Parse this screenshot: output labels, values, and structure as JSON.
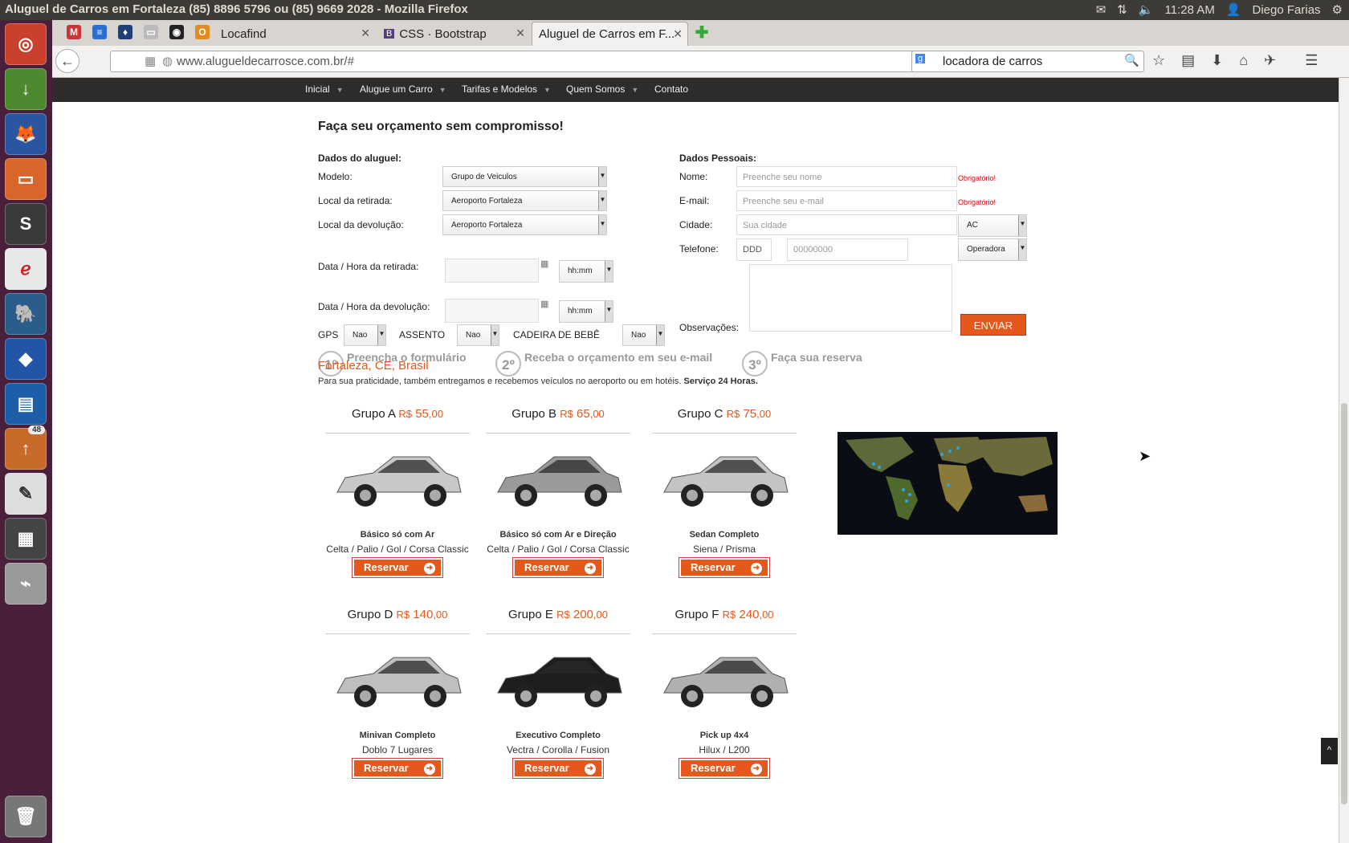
{
  "window_title": "Aluguel de Carros em Fortaleza (85) 8896 5796 ou (85) 9669 2028 - Mozilla Firefox",
  "tray": {
    "time": "11:28 AM",
    "user": "Diego Farias"
  },
  "launcher": {
    "badge": "48"
  },
  "tabs": [
    {
      "label": "Locafind"
    },
    {
      "label": "CSS · Bootstrap"
    },
    {
      "label": "Aluguel de Carros em F..."
    }
  ],
  "url": "www.alugueldecarrosce.com.br/#",
  "search_query": "locadora de carros",
  "site_menu": [
    "Inicial",
    "Alugue um Carro",
    "Tarifas e Modelos",
    "Quem Somos",
    "Contato"
  ],
  "form": {
    "heading": "Faça seu orçamento sem compromisso!",
    "rental_title": "Dados do aluguel:",
    "personal_title": "Dados Pessoais:",
    "modelo_label": "Modelo:",
    "modelo_value": "Grupo de Veiculos",
    "retirada_label": "Local da retirada:",
    "retirada_value": "Aeroporto Fortaleza",
    "devolucao_label": "Local da devolução:",
    "devolucao_value": "Aeroporto Fortaleza",
    "data_retirada_label": "Data / Hora da retirada:",
    "data_devolucao_label": "Data / Hora da devolução:",
    "hora_placeholder": "hh:mm",
    "gps_label": "GPS",
    "assento_label": "ASSENTO",
    "cadeira_label": "CADEIRA DE BEBÊ",
    "nao": "Nao",
    "nome_label": "Nome:",
    "nome_placeholder": "Preenche seu nome",
    "email_label": "E-mail:",
    "email_placeholder": "Preenche seu e-mail",
    "required": "Obrigatório!",
    "cidade_label": "Cidade:",
    "cidade_placeholder": "Sua cidade",
    "uf_value": "AC",
    "telefone_label": "Telefone:",
    "ddd_placeholder": "DDD",
    "phone_placeholder": "00000000",
    "operadora_value": "Operadora",
    "obs_label": "Observações:",
    "send_label": "ENVIAR"
  },
  "steps": [
    {
      "num": "1º",
      "text": "Preencha o formulário"
    },
    {
      "num": "2º",
      "text": "Receba o orçamento em seu e-mail"
    },
    {
      "num": "3º",
      "text": "Faça sua reserva"
    }
  ],
  "location": {
    "city": "Fortaleza, CE, Brasil",
    "note": "Para sua praticidade, também entregamos e recebemos veículos no aeroporto ou em hotéis.",
    "note_bold": "Serviço 24 Horas."
  },
  "groups": [
    {
      "name": "Grupo A",
      "currency": "R$",
      "price": "55",
      "cents": ",00",
      "desc": "Básico só com Ar",
      "models": "Celta / Palio / Gol / Corsa Classic",
      "color": "#c8c8c8"
    },
    {
      "name": "Grupo B",
      "currency": "R$",
      "price": "65",
      "cents": ",00",
      "desc": "Básico só com Ar e Direção",
      "models": "Celta / Palio / Gol / Corsa Classic",
      "color": "#9a9a9a"
    },
    {
      "name": "Grupo C",
      "currency": "R$",
      "price": "75",
      "cents": ",00",
      "desc": "Sedan Completo",
      "models": "Siena / Prisma",
      "color": "#c4c4c4"
    },
    {
      "name": "Grupo D",
      "currency": "R$",
      "price": "140",
      "cents": ",00",
      "desc": "Minivan Completo",
      "models": "Doblo 7 Lugares",
      "color": "#bfbfbf"
    },
    {
      "name": "Grupo E",
      "currency": "R$",
      "price": "200",
      "cents": ",00",
      "desc": "Executivo Completo",
      "models": "Vectra / Corolla / Fusion",
      "color": "#1e1e1e"
    },
    {
      "name": "Grupo F",
      "currency": "R$",
      "price": "240",
      "cents": ",00",
      "desc": "Pick up 4x4",
      "models": "Hilux / L200",
      "color": "#b0b0b0"
    }
  ],
  "reserve_label": "Reservar",
  "accent_color": "#e5581b"
}
